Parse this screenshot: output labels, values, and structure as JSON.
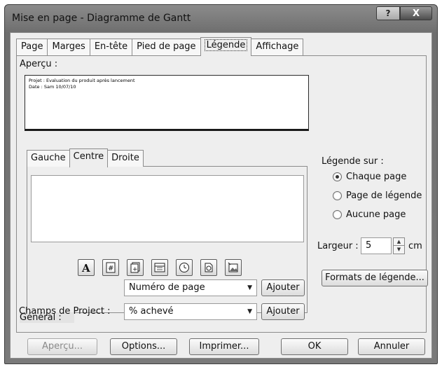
{
  "window": {
    "title": "Mise en page - Diagramme de Gantt",
    "help_label": "?",
    "close_label": "X"
  },
  "tabs": [
    {
      "label": "Page",
      "active": false
    },
    {
      "label": "Marges",
      "active": false
    },
    {
      "label": "En-tête",
      "active": false
    },
    {
      "label": "Pied de page",
      "active": false
    },
    {
      "label": "Légende",
      "active": true
    },
    {
      "label": "Affichage",
      "active": false
    }
  ],
  "preview": {
    "label": "Aperçu :",
    "line1": "Projet : Evaluation du produit après lancement",
    "line2": "Date : Sam 10/07/10"
  },
  "subtabs": [
    {
      "label": "Gauche",
      "active": false
    },
    {
      "label": "Centre",
      "active": true
    },
    {
      "label": "Droite",
      "active": false
    }
  ],
  "insert_icons": [
    "text-format-icon",
    "page-number-icon",
    "page-count-icon",
    "date-icon",
    "time-icon",
    "file-name-icon",
    "picture-icon"
  ],
  "general": {
    "label": "Général :",
    "value": "Numéro de page",
    "add_label": "Ajouter"
  },
  "project_fields": {
    "label": "Champs de Project :",
    "value": "% achevé",
    "add_label": "Ajouter"
  },
  "legend_on": {
    "label": "Légende sur :",
    "options": [
      {
        "label": "Chaque page",
        "checked": true
      },
      {
        "label": "Page de légende",
        "checked": false
      },
      {
        "label": "Aucune page",
        "checked": false
      }
    ]
  },
  "width": {
    "label": "Largeur :",
    "value": "5",
    "unit": "cm"
  },
  "formats_button": "Formats de légende...",
  "footer": {
    "preview_label": "Aperçu...",
    "options_label": "Options...",
    "print_label": "Imprimer...",
    "ok_label": "OK",
    "cancel_label": "Annuler"
  }
}
